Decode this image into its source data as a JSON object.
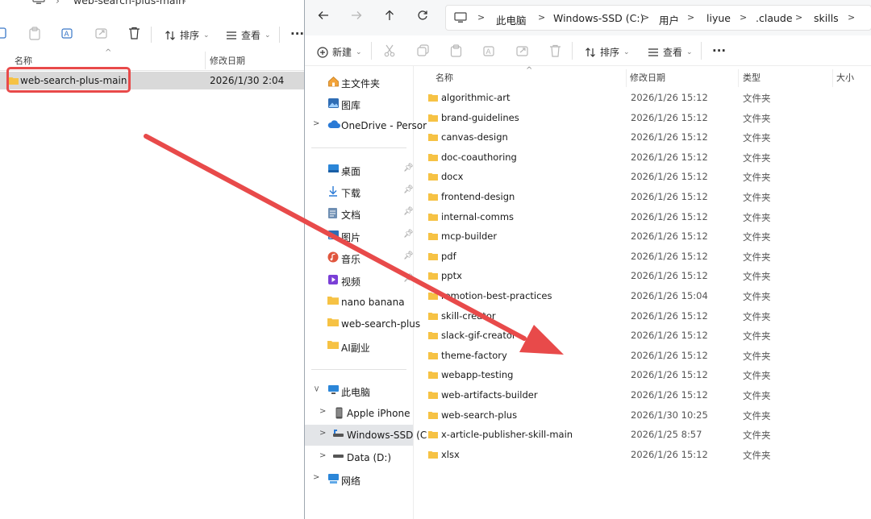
{
  "left_window": {
    "path_name": "web-search-plus-main",
    "toolbar": {
      "sort_label": "排序",
      "view_label": "查看",
      "more_label": "···"
    },
    "columns": {
      "name": "名称",
      "date": "修改日期"
    },
    "row": {
      "name": "web-search-plus-main",
      "date": "2026/1/30 2:04"
    }
  },
  "right_window": {
    "breadcrumbs": [
      "此电脑",
      "Windows-SSD (C:)",
      "用户",
      "liyue",
      ".claude",
      "skills"
    ],
    "toolbar": {
      "new_label": "新建",
      "sort_label": "排序",
      "view_label": "查看",
      "more_label": "···"
    },
    "nav": {
      "home": "主文件夹",
      "gallery": "图库",
      "onedrive": "OneDrive - Persor",
      "desktop": "桌面",
      "downloads": "下载",
      "documents": "文档",
      "pictures": "图片",
      "music": "音乐",
      "videos": "视频",
      "nano": "nano banana",
      "wsp": "web-search-plus",
      "ai": "AI副业",
      "thispc": "此电脑",
      "iphone": "Apple iPhone",
      "cdrive": "Windows-SSD (C",
      "ddrive": "Data (D:)",
      "network": "网络"
    },
    "columns": {
      "name": "名称",
      "date": "修改日期",
      "type": "类型",
      "size": "大小"
    },
    "files": [
      {
        "name": "algorithmic-art",
        "date": "2026/1/26 15:12",
        "type": "文件夹"
      },
      {
        "name": "brand-guidelines",
        "date": "2026/1/26 15:12",
        "type": "文件夹"
      },
      {
        "name": "canvas-design",
        "date": "2026/1/26 15:12",
        "type": "文件夹"
      },
      {
        "name": "doc-coauthoring",
        "date": "2026/1/26 15:12",
        "type": "文件夹"
      },
      {
        "name": "docx",
        "date": "2026/1/26 15:12",
        "type": "文件夹"
      },
      {
        "name": "frontend-design",
        "date": "2026/1/26 15:12",
        "type": "文件夹"
      },
      {
        "name": "internal-comms",
        "date": "2026/1/26 15:12",
        "type": "文件夹"
      },
      {
        "name": "mcp-builder",
        "date": "2026/1/26 15:12",
        "type": "文件夹"
      },
      {
        "name": "pdf",
        "date": "2026/1/26 15:12",
        "type": "文件夹"
      },
      {
        "name": "pptx",
        "date": "2026/1/26 15:12",
        "type": "文件夹"
      },
      {
        "name": "remotion-best-practices",
        "date": "2026/1/26 15:04",
        "type": "文件夹"
      },
      {
        "name": "skill-creator",
        "date": "2026/1/26 15:12",
        "type": "文件夹"
      },
      {
        "name": "slack-gif-creator",
        "date": "2026/1/26 15:12",
        "type": "文件夹"
      },
      {
        "name": "theme-factory",
        "date": "2026/1/26 15:12",
        "type": "文件夹"
      },
      {
        "name": "webapp-testing",
        "date": "2026/1/26 15:12",
        "type": "文件夹"
      },
      {
        "name": "web-artifacts-builder",
        "date": "2026/1/26 15:12",
        "type": "文件夹"
      },
      {
        "name": "web-search-plus",
        "date": "2026/1/30 10:25",
        "type": "文件夹"
      },
      {
        "name": "x-article-publisher-skill-main",
        "date": "2026/1/25 8:57",
        "type": "文件夹"
      },
      {
        "name": "xlsx",
        "date": "2026/1/26 15:12",
        "type": "文件夹"
      }
    ]
  },
  "colors": {
    "arrow": "#e84a4a",
    "highlight": "#e84a4a",
    "folder": "#f6c244",
    "selected_row": "#d9d9d9"
  }
}
